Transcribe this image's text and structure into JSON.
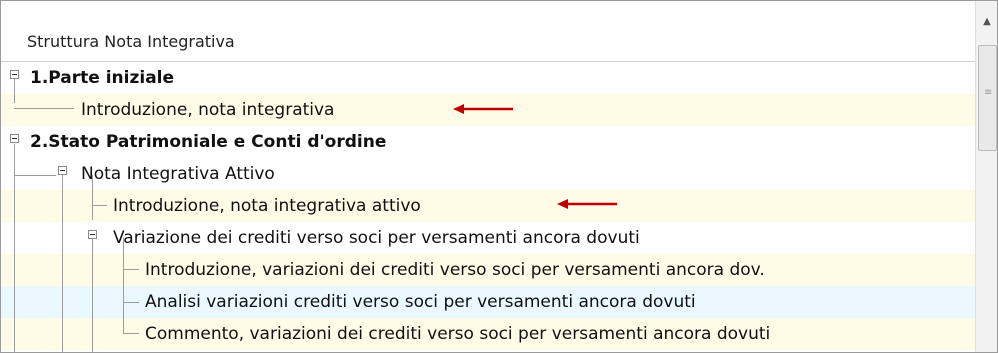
{
  "panel": {
    "header": "Struttura Nota Integrativa",
    "scroll_up_glyph": "▲",
    "grip_glyph": "≡"
  },
  "tree": [
    {
      "label": "1.Parte iniziale",
      "bold": true
    },
    {
      "label": "Introduzione, nota integrativa",
      "bold": false,
      "arrow": true
    },
    {
      "label": "2.Stato Patrimoniale e Conti d'ordine",
      "bold": true
    },
    {
      "label": "Nota Integrativa Attivo",
      "bold": false
    },
    {
      "label": "Introduzione, nota integrativa attivo",
      "bold": false,
      "arrow": true
    },
    {
      "label": "Variazione dei crediti verso soci per versamenti ancora dovuti",
      "bold": false
    },
    {
      "label": "Introduzione, variazioni dei crediti verso soci per versamenti ancora dov.",
      "bold": false
    },
    {
      "label": "Analisi variazioni crediti verso soci per versamenti ancora dovuti",
      "bold": false
    },
    {
      "label": "Commento, variazioni dei crediti verso soci per versamenti ancora dovuti",
      "bold": false
    }
  ],
  "colors": {
    "arrow": "#c00000",
    "row_highlight": "#fffbe6",
    "selected_row": "#eaf8ff",
    "tree_lines": "#9c9c9c"
  }
}
